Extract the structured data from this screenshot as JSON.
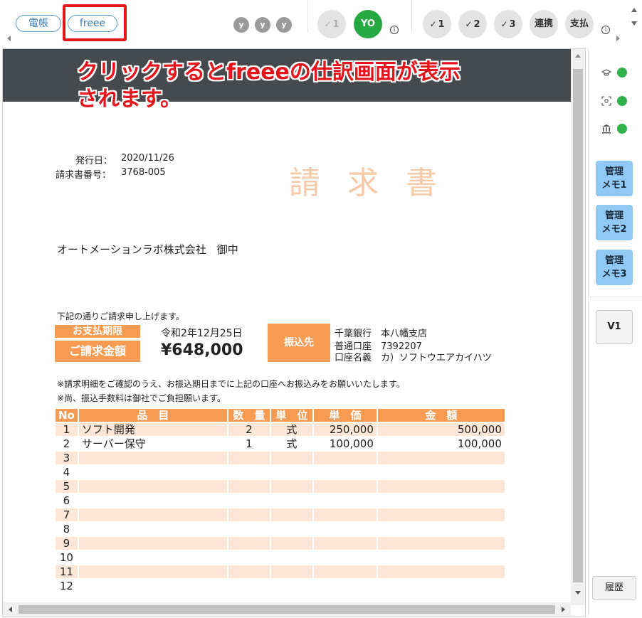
{
  "toolbar": {
    "pills": [
      "電帳",
      "freee"
    ],
    "y_badges": [
      "y",
      "y",
      "y"
    ],
    "group1": [
      {
        "label": "1",
        "check": "✓"
      },
      {
        "label": "YO"
      }
    ],
    "group2": [
      {
        "label": "1",
        "check": "✓"
      },
      {
        "label": "2",
        "check": "✓"
      },
      {
        "label": "3",
        "check": "✓"
      },
      {
        "label": "連携"
      },
      {
        "label": "支払"
      }
    ],
    "info_glyph": "i"
  },
  "annotation": {
    "line1": "クリックするとfreeeの仕訳画面が表示",
    "line2": "されます。"
  },
  "invoice": {
    "issue_date_label": "発行日：",
    "issue_date": "2020/11/26",
    "invoice_no_label": "請求書番号：",
    "invoice_no": "3768-005",
    "title": "請求書",
    "recipient": "オートメーションラボ株式会社　御中",
    "intro": "下記の通りご請求申し上げます。",
    "due_label": "お支払期限",
    "due_date": "令和2年12月25日",
    "amount_label": "ご請求金額",
    "amount": "¥648,000",
    "bank_label": "振込先",
    "bank_lines": [
      "千葉銀行　本八幡支店",
      "普通口座　7392207",
      "口座名義　カ）ソフトウエアカイハツ"
    ],
    "notes": [
      "※請求明細をご確認のうえ、お振込期日までに上記の口座へお振込みをお願いいたします。",
      "※尚、振込手数料は御社でご負担願います。"
    ],
    "table_headers": [
      "No",
      "品　目",
      "数　量",
      "単　位",
      "単　価",
      "金　額"
    ],
    "rows": [
      {
        "no": "1",
        "name": "ソフト開発",
        "qty": "2",
        "unit": "式",
        "price": "250,000",
        "amount": "500,000"
      },
      {
        "no": "2",
        "name": "サーバー保守",
        "qty": "1",
        "unit": "式",
        "price": "100,000",
        "amount": "100,000"
      },
      {
        "no": "3",
        "name": "",
        "qty": "",
        "unit": "",
        "price": "",
        "amount": ""
      },
      {
        "no": "4",
        "name": "",
        "qty": "",
        "unit": "",
        "price": "",
        "amount": ""
      },
      {
        "no": "5",
        "name": "",
        "qty": "",
        "unit": "",
        "price": "",
        "amount": ""
      },
      {
        "no": "6",
        "name": "",
        "qty": "",
        "unit": "",
        "price": "",
        "amount": ""
      },
      {
        "no": "7",
        "name": "",
        "qty": "",
        "unit": "",
        "price": "",
        "amount": ""
      },
      {
        "no": "8",
        "name": "",
        "qty": "",
        "unit": "",
        "price": "",
        "amount": ""
      },
      {
        "no": "9",
        "name": "",
        "qty": "",
        "unit": "",
        "price": "",
        "amount": ""
      },
      {
        "no": "10",
        "name": "",
        "qty": "",
        "unit": "",
        "price": "",
        "amount": ""
      },
      {
        "no": "11",
        "name": "",
        "qty": "",
        "unit": "",
        "price": "",
        "amount": ""
      },
      {
        "no": "12",
        "name": "",
        "qty": "",
        "unit": "",
        "price": "",
        "amount": ""
      }
    ]
  },
  "right_panel": {
    "status_icons": [
      {
        "icon": "graduation-cap-icon",
        "status_color": "#32b34a"
      },
      {
        "icon": "scan-icon",
        "status_color": "#32b34a"
      },
      {
        "icon": "bank-icon",
        "status_color": "#32b34a"
      }
    ],
    "memo_buttons": [
      {
        "line1": "管理",
        "line2": "メモ1"
      },
      {
        "line1": "管理",
        "line2": "メモ2"
      },
      {
        "line1": "管理",
        "line2": "メモ3"
      }
    ],
    "version_label": "V1",
    "history_label": "履歴"
  },
  "colors": {
    "accent_orange": "#f79a52",
    "row_shade": "#fde6d6",
    "annotation_red": "#e4141c",
    "memo_blue": "#8fc9f4",
    "status_green": "#32b34a"
  }
}
